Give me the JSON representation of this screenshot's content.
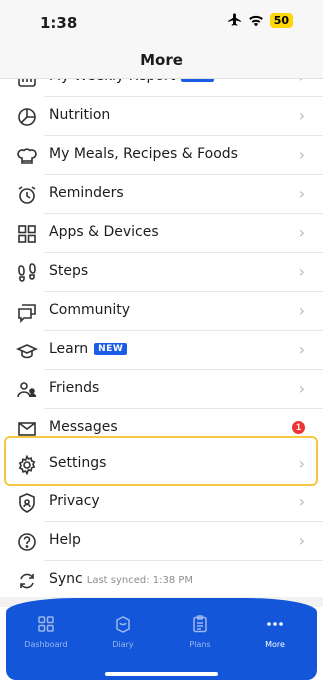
{
  "status_bar": {
    "time": "1:38",
    "battery": "50",
    "airplane_icon": "airplane-icon",
    "wifi_icon": "wifi-icon"
  },
  "header": {
    "title": "More"
  },
  "menu": {
    "items": [
      {
        "label": "My Weekly Report",
        "badge": "NEW",
        "icon": "report-icon"
      },
      {
        "label": "Nutrition",
        "icon": "pie-chart-icon"
      },
      {
        "label": "My Meals, Recipes & Foods",
        "icon": "chef-hat-icon"
      },
      {
        "label": "Reminders",
        "icon": "alarm-clock-icon"
      },
      {
        "label": "Apps & Devices",
        "icon": "grid-icon"
      },
      {
        "label": "Steps",
        "icon": "footprints-icon"
      },
      {
        "label": "Community",
        "icon": "chat-icon"
      },
      {
        "label": "Learn",
        "badge": "NEW",
        "icon": "graduation-cap-icon"
      },
      {
        "label": "Friends",
        "icon": "friends-icon"
      },
      {
        "label": "Messages",
        "notification_count": "1",
        "icon": "envelope-icon"
      },
      {
        "label": "Settings",
        "icon": "gear-icon"
      },
      {
        "label": "Privacy",
        "icon": "shield-icon"
      },
      {
        "label": "Help",
        "icon": "help-icon"
      },
      {
        "label": "Sync",
        "sublabel": "Last synced: 1:38 PM",
        "icon": "sync-icon"
      }
    ]
  },
  "tabbar": {
    "tabs": [
      {
        "label": "Dashboard",
        "icon": "dashboard-icon"
      },
      {
        "label": "Diary",
        "icon": "diary-icon"
      },
      {
        "label": "Plans",
        "icon": "clipboard-icon"
      },
      {
        "label": "More",
        "icon": "more-dots-icon",
        "active": true
      }
    ]
  },
  "colors": {
    "accent": "#1356d9",
    "highlight": "#f5c842",
    "badge": "#1a5ce6",
    "notification": "#e33333"
  }
}
